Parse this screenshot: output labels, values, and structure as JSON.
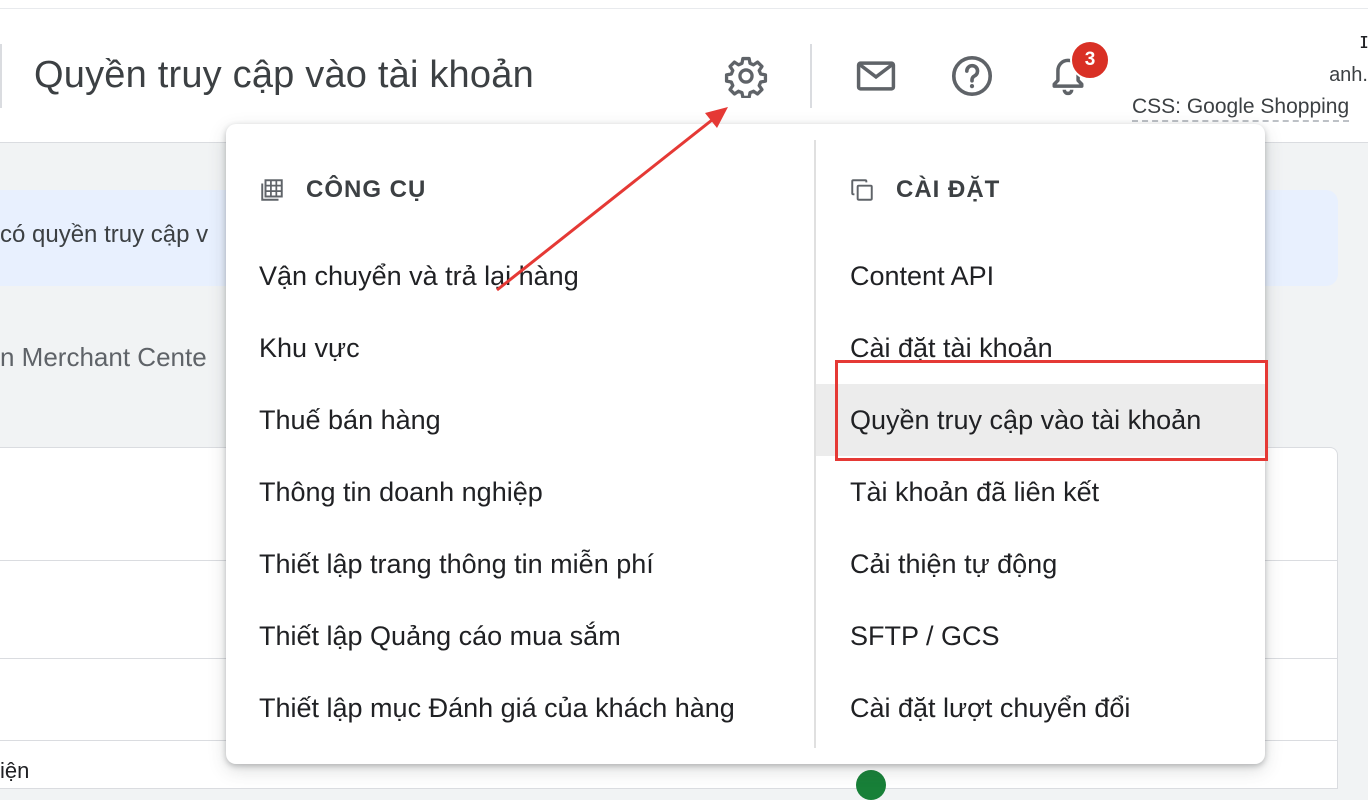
{
  "header": {
    "title": "Quyền truy cập vào tài khoản",
    "icons": {
      "settings": "gear-icon",
      "mail": "mail-icon",
      "help": "help-icon",
      "notifications": "bell-icon"
    },
    "notification_count": "3",
    "account_line_cut": "ɪ",
    "account_name_cut": "anh.",
    "account_css": "CSS: Google Shopping"
  },
  "background": {
    "banner_text": "có quyền truy cập v",
    "section_text": "n Merchant Cente",
    "card_cut_text": "iện"
  },
  "menu": {
    "tools": {
      "heading": "CÔNG CỤ",
      "icon": "table-icon",
      "items": [
        "Vận chuyển và trả lại hàng",
        "Khu vực",
        "Thuế bán hàng",
        "Thông tin doanh nghiệp",
        "Thiết lập trang thông tin miễn phí",
        "Thiết lập Quảng cáo mua sắm",
        "Thiết lập mục Đánh giá của khách hàng"
      ]
    },
    "settings": {
      "heading": "CÀI ĐẶT",
      "icon": "copy-icon",
      "items": [
        "Content API",
        "Cài đặt tài khoản",
        "Quyền truy cập vào tài khoản",
        "Tài khoản đã liên kết",
        "Cải thiện tự động",
        "SFTP / GCS",
        "Cài đặt lượt chuyển đổi"
      ],
      "active_item": "Quyền truy cập vào tài khoản"
    }
  },
  "annotation": {
    "arrow_color": "#e53935",
    "highlight_color": "#e53935"
  },
  "colors": {
    "badge": "#d93025",
    "banner": "#e8f0fe",
    "active_item_bg": "#ececec"
  }
}
